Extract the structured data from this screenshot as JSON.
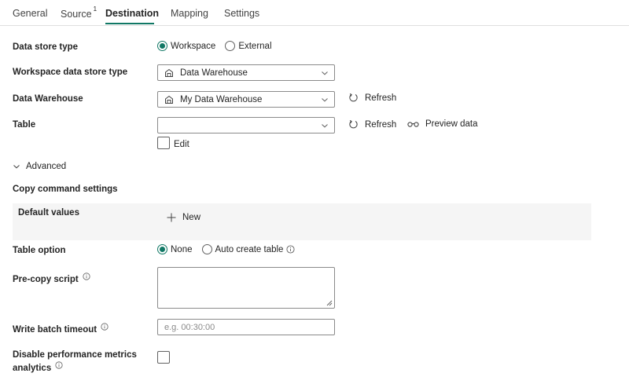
{
  "tabs": [
    {
      "label": "General"
    },
    {
      "label": "Source",
      "badge": "1"
    },
    {
      "label": "Destination",
      "active": true
    },
    {
      "label": "Mapping"
    },
    {
      "label": "Settings"
    }
  ],
  "form": {
    "data_store_type": {
      "label": "Data store type",
      "options": [
        "Workspace",
        "External"
      ],
      "selected": "Workspace"
    },
    "workspace_data_store_type": {
      "label": "Workspace data store type",
      "value": "Data Warehouse",
      "icon": "warehouse-icon"
    },
    "data_warehouse": {
      "label": "Data Warehouse",
      "value": "My Data Warehouse",
      "icon": "warehouse-icon",
      "refresh_label": "Refresh"
    },
    "table": {
      "label": "Table",
      "value": "",
      "refresh_label": "Refresh",
      "preview_label": "Preview data",
      "edit_label": "Edit"
    },
    "advanced": {
      "label": "Advanced",
      "expanded": true
    },
    "copy_command_settings": {
      "label": "Copy command settings"
    },
    "default_values": {
      "label": "Default values",
      "new_label": "New"
    },
    "table_option": {
      "label": "Table option",
      "options": [
        "None",
        "Auto create table"
      ],
      "selected": "None"
    },
    "pre_copy_script": {
      "label": "Pre-copy script",
      "value": ""
    },
    "write_batch_timeout": {
      "label": "Write batch timeout",
      "placeholder": "e.g. 00:30:00",
      "value": ""
    },
    "disable_perf_metrics": {
      "label_line1": "Disable performance metrics",
      "label_line2": "analytics",
      "checked": false
    }
  },
  "colors": {
    "accent": "#117865",
    "text": "#242424",
    "border": "#8a8a8a",
    "panel": "#f5f5f5"
  }
}
